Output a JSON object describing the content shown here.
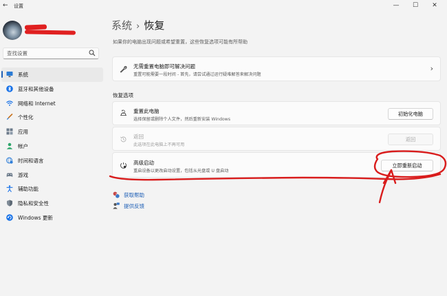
{
  "window": {
    "title": "设置",
    "back_glyph": "←",
    "minimize_glyph": "—",
    "maximize_glyph": "☐",
    "close_glyph": "✕"
  },
  "sidebar": {
    "search_placeholder": "查找设置",
    "items": [
      {
        "label": "系统",
        "icon": "monitor-icon",
        "active": true
      },
      {
        "label": "蓝牙和其他设备",
        "icon": "bluetooth-icon"
      },
      {
        "label": "网络和 Internet",
        "icon": "wifi-icon"
      },
      {
        "label": "个性化",
        "icon": "brush-icon"
      },
      {
        "label": "应用",
        "icon": "apps-icon"
      },
      {
        "label": "帐户",
        "icon": "person-icon"
      },
      {
        "label": "时间和语言",
        "icon": "globe-clock-icon"
      },
      {
        "label": "游戏",
        "icon": "gamepad-icon"
      },
      {
        "label": "辅助功能",
        "icon": "accessibility-icon"
      },
      {
        "label": "隐私和安全性",
        "icon": "shield-icon"
      },
      {
        "label": "Windows 更新",
        "icon": "update-icon"
      }
    ]
  },
  "main": {
    "breadcrumb_parent": "系统",
    "breadcrumb_sep": "›",
    "breadcrumb_current": "恢复",
    "intro": "如果你的电脑出现问题或希望重置，这些恢复选项可能有所帮助",
    "fix_card": {
      "title": "无需重置电脑即可解决问题",
      "desc": "重置可能需要一段时间 - 首先，请尝试通过运行疑难解答来解决问题",
      "chevron": "›"
    },
    "section_title": "恢复选项",
    "reset_card": {
      "title": "重置此电脑",
      "desc": "选择保留或删除个人文件，然后重新安装 Windows",
      "button": "初始化电脑"
    },
    "goback_card": {
      "title": "返回",
      "desc": "此选项在此电脑上不再可用",
      "button": "返回"
    },
    "advanced_card": {
      "title": "高级启动",
      "desc": "重启设备以更改启动设置，包括从光盘或 U 盘启动",
      "button": "立即重新启动"
    },
    "links": [
      {
        "label": "获取帮助",
        "icon": "help-icon"
      },
      {
        "label": "提供反馈",
        "icon": "feedback-icon"
      }
    ]
  },
  "colors": {
    "accent": "#1e5fb6",
    "annotation": "#d91c1c",
    "background": "#f3f3f3",
    "card": "#fbfbfb"
  }
}
